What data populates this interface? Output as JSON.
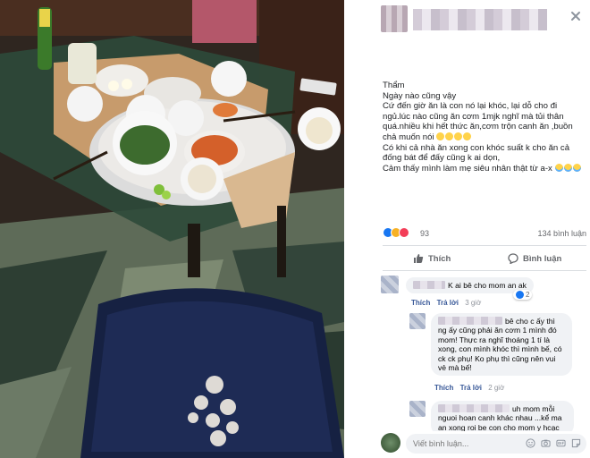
{
  "post": {
    "paragraphs": [
      "Thẩm",
      "Ngày nào cũng vậy",
      "Cứ đến giờ ăn là con nó lại khóc, lại dỗ cho đi ngủ.lúc nào cũng ăn cơm 1mjk nghĩ mà tủi thân quá.nhiều khi hết thức ăn,cơm trộn canh ăn ,buồn chả muốn nói",
      "Có khi cả nhà ăn xong con khóc suất k cho ăn cả đống bát để đấy cũng k ai dọn,",
      "Cảm thấy mình làm mẹ siêu nhân thật từ a-x"
    ],
    "reaction_count": "93",
    "comment_count": "134 bình luận",
    "like_label": "Thích",
    "comment_label": "Bình luận"
  },
  "comments": [
    {
      "text": "K ai bê cho mom an ak",
      "like": "Thích",
      "reply": "Trả lời",
      "time": "3 giờ",
      "reaction_count": "2"
    },
    {
      "text": "bê cho c ấy thì ng ấy cũng phải ăn cơm 1 mình đó mom! Thực ra nghĩ thoáng 1 tí là xong, con mình khóc thì mình bế, có ck ck phụ! Ko phụ thì cũng nên vui vẻ mà bế!",
      "like": "Thích",
      "reply": "Trả lời",
      "time": "2 giờ"
    },
    {
      "text": "uh mom mỗi nguoi hoan canh khác nhau ...kể ma an xong roi be con cho mom y hcạc"
    }
  ],
  "composer": {
    "placeholder": "Viết bình luận..."
  },
  "icons": {
    "close": "close-icon",
    "like": "thumbs-up-icon",
    "comment": "speech-bubble-icon",
    "emoji": "emoji-icon",
    "camera": "camera-icon",
    "gif": "gif-icon",
    "sticker": "sticker-icon"
  },
  "colors": {
    "link": "#385898",
    "like_blue": "#1877f2",
    "muted": "#65676b",
    "bubble": "#f0f2f5"
  }
}
